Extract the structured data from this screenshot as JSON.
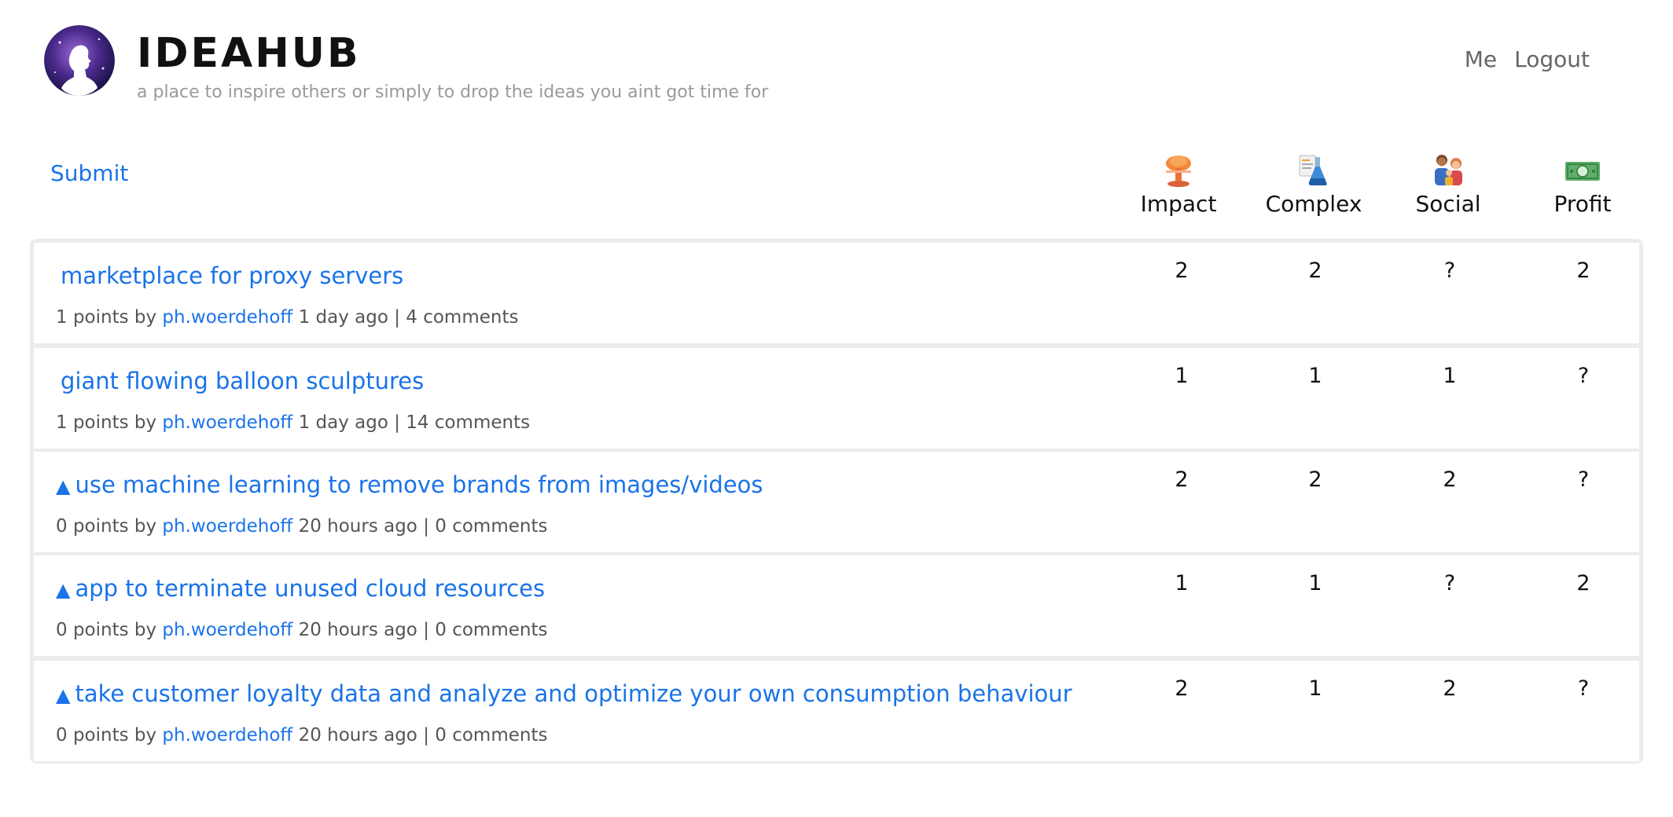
{
  "header": {
    "title": "IDEAHUB",
    "tagline": "a place to inspire others or simply to drop the ideas you aint got time for",
    "nav": [
      "Me",
      "Logout"
    ],
    "logo_icon": "avatar-silhouette-icon"
  },
  "toolbar": {
    "submit_label": "Submit"
  },
  "columns": [
    {
      "label": "Impact",
      "icon": "mushroom-cloud-icon"
    },
    {
      "label": "Complex",
      "icon": "lab-flask-icon"
    },
    {
      "label": "Social",
      "icon": "family-icon"
    },
    {
      "label": "Profit",
      "icon": "banknote-icon"
    }
  ],
  "ideas": [
    {
      "arrow": "",
      "title": "marketplace for proxy servers",
      "points": "1 points by",
      "author": "ph.woerdehoff",
      "age": "1 day ago",
      "sep": "|",
      "comments": "4 comments",
      "scores": [
        "2",
        "2",
        "?",
        "2"
      ]
    },
    {
      "arrow": "",
      "title": "giant flowing balloon sculptures",
      "points": "1 points by",
      "author": "ph.woerdehoff",
      "age": "1 day ago",
      "sep": "|",
      "comments": "14 comments",
      "scores": [
        "1",
        "1",
        "1",
        "?"
      ]
    },
    {
      "arrow": "▲",
      "title": "use machine learning to remove brands from images/videos",
      "points": "0 points by",
      "author": "ph.woerdehoff",
      "age": "20 hours ago",
      "sep": "|",
      "comments": "0 comments",
      "scores": [
        "2",
        "2",
        "2",
        "?"
      ]
    },
    {
      "arrow": "▲",
      "title": "app to terminate unused cloud resources",
      "points": "0 points by",
      "author": "ph.woerdehoff",
      "age": "20 hours ago",
      "sep": "|",
      "comments": "0 comments",
      "scores": [
        "1",
        "1",
        "?",
        "2"
      ]
    },
    {
      "arrow": "▲",
      "title": "take customer loyalty data and analyze and optimize your own consumption behaviour",
      "points": "0 points by",
      "author": "ph.woerdehoff",
      "age": "20 hours ago",
      "sep": "|",
      "comments": "0 comments",
      "scores": [
        "2",
        "1",
        "2",
        "?"
      ]
    }
  ],
  "colors": {
    "link": "#1a73e8",
    "muted": "#9a9a9a",
    "border": "#ececec"
  }
}
